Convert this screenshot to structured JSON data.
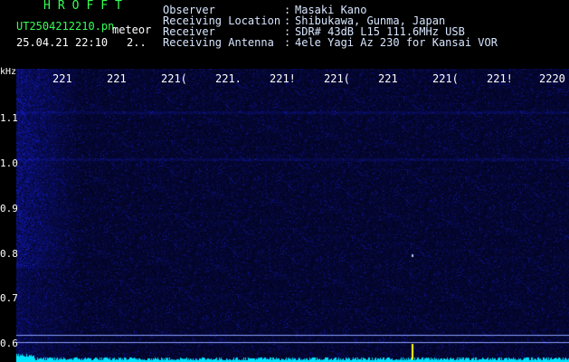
{
  "header": {
    "title": "HROFFT",
    "filename": "UT2504212210.pn",
    "meteor_label": "meteor",
    "date_time": "25.04.21 22:10",
    "counter": "2..",
    "fields": [
      {
        "label": "Observer",
        "value": "Masaki Kano"
      },
      {
        "label": "Receiving Location",
        "value": "Shibukawa, Gunma, Japan"
      },
      {
        "label": "Receiver",
        "value": "SDR# 43dB L15 111.6MHz USB"
      },
      {
        "label": "Receiving Antenna",
        "value": "4ele Yagi Az 230 for Kansai VOR"
      }
    ],
    "separator": ":"
  },
  "spectrogram": {
    "y_unit": "kHz",
    "y_ticks": [
      "1.1",
      "1.0",
      "0.9",
      "0.8",
      "0.7",
      "0.6"
    ],
    "x_ticks": [
      "221",
      "221",
      "221(",
      "221.",
      "221!",
      "221(",
      "221",
      "221(",
      "221!",
      "2220"
    ],
    "colors": {
      "background": "#00001a",
      "noise": "#3040ff",
      "signal": "#ffff00",
      "baseline": "#00e5ff"
    }
  }
}
